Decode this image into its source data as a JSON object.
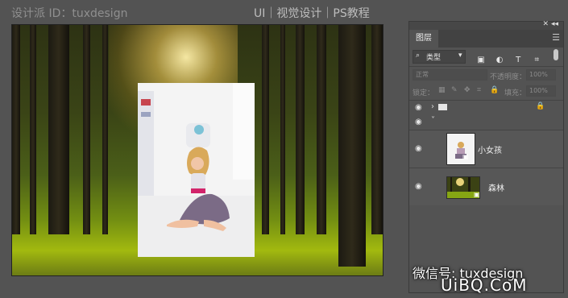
{
  "window": {
    "left_title": "设计派 ID：tuxdesign",
    "right_title": "UI｜视觉设计｜PS教程"
  },
  "panel": {
    "collapse": "◂◂",
    "close": "✕",
    "tab_label": "图层",
    "menu": "☰",
    "filter_label": "类型",
    "filter_icons": [
      "▣",
      "◐",
      "T",
      "⌗",
      "▤"
    ],
    "blend_mode": "正常",
    "opacity_label": "不透明度：",
    "opacity_value": "100%",
    "lock_label": "锁定：",
    "lock_icons": [
      "▦",
      "✎",
      "✥",
      "⌗",
      "🔒"
    ],
    "fill_label": "填充：",
    "fill_value": "100%"
  },
  "layers": [
    {
      "name": "",
      "type": "group",
      "visible": true,
      "locked": true
    },
    {
      "name": "",
      "type": "group-expanded",
      "visible": true
    },
    {
      "name": "小女孩",
      "type": "smart-object",
      "visible": true
    },
    {
      "name": "森林",
      "type": "smart-object",
      "visible": true
    }
  ],
  "watermarks": {
    "wechat": "微信号: tuxdesign",
    "site": "UiBQ.CoM"
  },
  "colors": {
    "app_bg": "#535353",
    "panel_bg": "#535353",
    "accent_green": "#8fb512"
  }
}
